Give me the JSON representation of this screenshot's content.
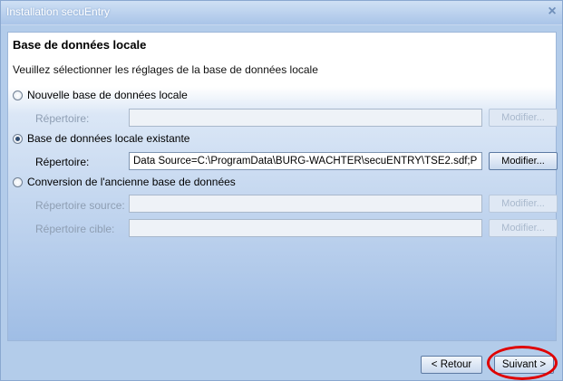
{
  "window": {
    "title": "Installation secuEntry",
    "close_glyph": "×"
  },
  "page": {
    "heading": "Base de données locale",
    "description": "Veuillez sélectionner les réglages de la base de données locale"
  },
  "options": [
    {
      "label": "Nouvelle base de données locale",
      "selected": false,
      "fields": [
        {
          "label": "Répertoire:",
          "value": "",
          "button": "Modifier...",
          "enabled": false
        }
      ]
    },
    {
      "label": "Base de données locale existante",
      "selected": true,
      "fields": [
        {
          "label": "Répertoire:",
          "value": "Data Source=C:\\ProgramData\\BURG-WACHTER\\secuENTRY\\TSE2.sdf;P",
          "button": "Modifier...",
          "enabled": true
        }
      ]
    },
    {
      "label": "Conversion de l'ancienne base de données",
      "selected": false,
      "fields": [
        {
          "label": "Répertoire source:",
          "value": "",
          "button": "Modifier...",
          "enabled": false
        },
        {
          "label": "Répertoire cible:",
          "value": "",
          "button": "Modifier...",
          "enabled": false
        }
      ]
    }
  ],
  "navigation": {
    "back_label": "< Retour",
    "next_label": "Suivant >"
  },
  "colors": {
    "highlight_ring": "#e00000",
    "window_frame": "#b3ccea"
  }
}
